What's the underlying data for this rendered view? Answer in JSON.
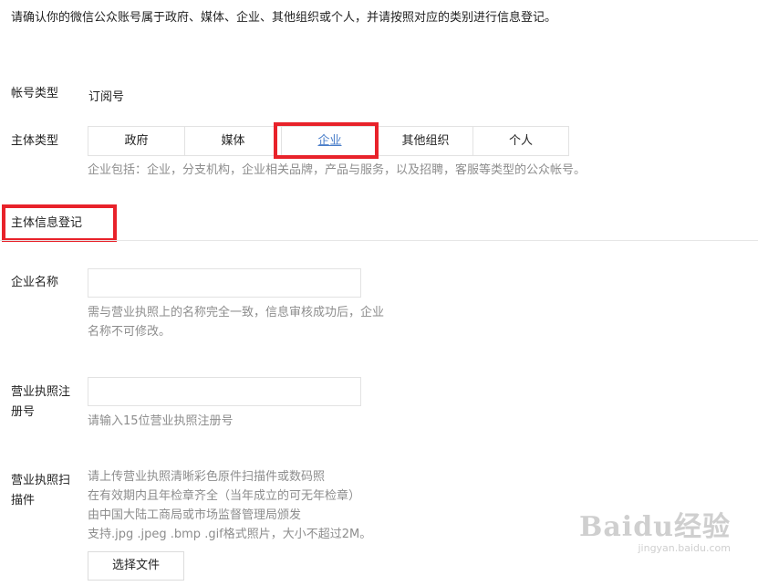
{
  "intro": "请确认你的微信公众账号属于政府、媒体、企业、其他组织或个人，并请按照对应的类别进行信息登记。",
  "account_type": {
    "label": "帐号类型",
    "value": "订阅号"
  },
  "subject_type": {
    "label": "主体类型",
    "options": [
      "政府",
      "媒体",
      "企业",
      "其他组织",
      "个人"
    ],
    "selected": "企业",
    "hint": "企业包括：企业，分支机构，企业相关品牌，产品与服务，以及招聘，客服等类型的公众帐号。"
  },
  "section_title": "主体信息登记",
  "company_name": {
    "label": "企业名称",
    "value": "",
    "hint_line1": "需与营业执照上的名称完全一致，信息审核成功后，企业",
    "hint_line2": "名称不可修改。"
  },
  "license_number": {
    "label_line1": "营业执照注",
    "label_line2": "册号",
    "value": "",
    "hint": "请输入15位营业执照注册号"
  },
  "license_scan": {
    "label_line1": "营业执照扫",
    "label_line2": "描件",
    "hints": [
      "请上传营业执照清晰彩色原件扫描件或数码照",
      "在有效期内且年检章齐全（当年成立的可无年检章）",
      "由中国大陆工商局或市场监督管理局颁发",
      "支持.jpg .jpeg .bmp .gif格式照片，大小不超过2M。"
    ],
    "button_label": "选择文件"
  },
  "watermark": {
    "logo": "Baidu经验",
    "url": "jingyan.baidu.com"
  },
  "colors": {
    "highlight_red": "#e8222a",
    "link_blue": "#4a7ec9",
    "hint_gray": "#8d8d8d"
  }
}
